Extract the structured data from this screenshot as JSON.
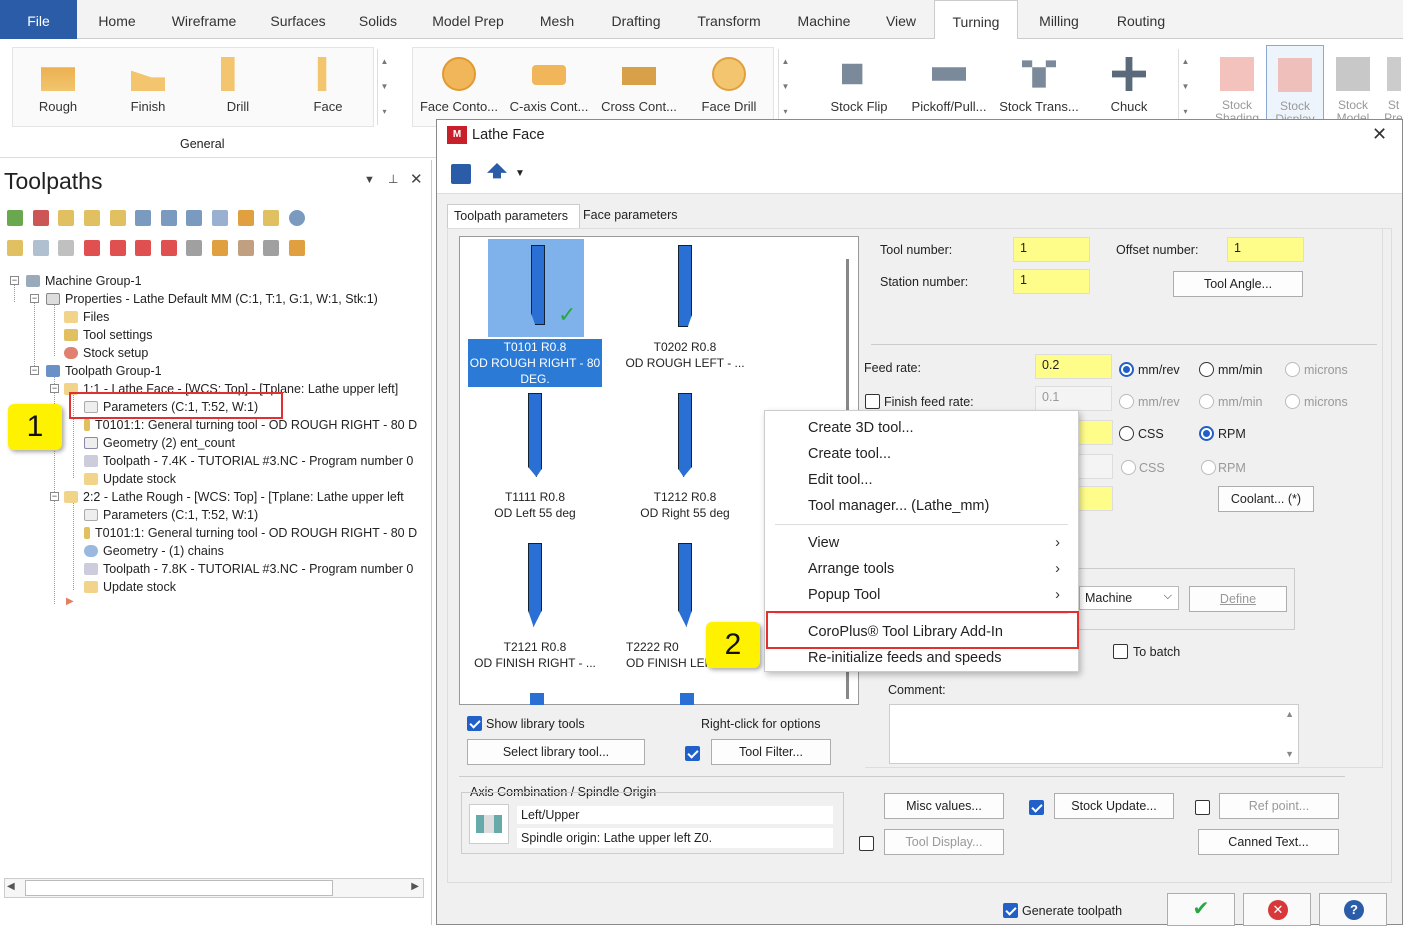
{
  "ribbon_tabs": [
    "File",
    "Home",
    "Wireframe",
    "Surfaces",
    "Solids",
    "Model Prep",
    "Mesh",
    "Drafting",
    "Transform",
    "Machine",
    "View",
    "Turning",
    "Milling",
    "Routing"
  ],
  "ribbon": {
    "general_buttons": [
      "Rough",
      "Finish",
      "Drill",
      "Face"
    ],
    "general_label": "General",
    "mid_buttons": [
      "Face Conto...",
      "C-axis Cont...",
      "Cross Cont...",
      "Face Drill"
    ],
    "stock_buttons": [
      "Stock Flip",
      "Pickoff/Pull...",
      "Stock Trans...",
      "Chuck"
    ],
    "display_buttons": [
      "Stock Shading",
      "Stock Display",
      "Stock Model",
      "St Pre"
    ]
  },
  "toolpaths": {
    "title": "Toolpaths",
    "tree": [
      "Machine Group-1",
      "Properties - Lathe Default MM  (C:1, T:1, G:1, W:1, Stk:1)",
      "Files",
      "Tool settings",
      "Stock setup",
      "Toolpath Group-1",
      "1:1 - Lathe Face - [WCS: Top] - [Tplane: Lathe upper left]",
      "Parameters  (C:1, T:52, W:1)",
      "T0101:1: General turning tool - OD ROUGH RIGHT - 80 D",
      "Geometry (2) ent_count",
      "Toolpath - 7.4K - TUTORIAL #3.NC - Program number 0",
      "Update stock",
      "2:2 - Lathe Rough - [WCS: Top] - [Tplane: Lathe upper left",
      "Parameters  (C:1, T:52, W:1)",
      "T0101:1: General turning tool - OD ROUGH RIGHT - 80 D",
      "Geometry - (1) chains",
      "Toolpath - 7.8K - TUTORIAL #3.NC - Program number 0",
      "Update stock"
    ]
  },
  "callouts": [
    "1",
    "2"
  ],
  "dialog": {
    "title": "Lathe Face",
    "tabs": [
      "Toolpath parameters",
      "Face parameters"
    ],
    "tools": [
      {
        "line1": "T0101 R0.8",
        "line2": "OD ROUGH RIGHT - 80",
        "line3": "DEG."
      },
      {
        "line1": "T0202 R0.8",
        "line2": "OD ROUGH LEFT - ..."
      },
      {
        "line1": "T1111 R0.8",
        "line2": "OD Left 55 deg"
      },
      {
        "line1": "T1212 R0.8",
        "line2": "OD Right 55 deg"
      },
      {
        "line1": "T2121 R0.8",
        "line2": "OD FINISH RIGHT - ..."
      },
      {
        "line1": "T2222 R0",
        "line2": "OD FINISH LEF"
      }
    ],
    "tool_number_label": "Tool number:",
    "tool_number": "1",
    "offset_number_label": "Offset number:",
    "offset_number": "1",
    "station_number_label": "Station number:",
    "station_number": "1",
    "tool_angle": "Tool Angle...",
    "feed_rate_label": "Feed rate:",
    "feed_rate": "0.2",
    "finish_feed_label": "Finish feed rate:",
    "finish_feed": "0.1",
    "units": [
      "mm/rev",
      "mm/min",
      "microns"
    ],
    "css": "CSS",
    "rpm": "RPM",
    "coolant": "Coolant... (*)",
    "machine_select": "Machine",
    "define": "Define",
    "to_batch": "To batch",
    "comment_label": "Comment:",
    "show_library": "Show library tools",
    "right_click": "Right-click for options",
    "select_library": "Select library tool...",
    "tool_filter": "Tool Filter...",
    "axis_combo_label": "Axis Combination / Spindle Origin",
    "axis_value": "Left/Upper",
    "spindle_origin": "Spindle origin: Lathe upper left   Z0.",
    "misc_values": "Misc values...",
    "stock_update": "Stock Update...",
    "ref_point": "Ref point...",
    "tool_display": "Tool Display...",
    "canned_text": "Canned Text...",
    "generate_toolpath": "Generate toolpath"
  },
  "context_menu": {
    "items": [
      "Create 3D tool...",
      "Create tool...",
      "Edit tool...",
      "Tool manager... (Lathe_mm)"
    ],
    "submenus": [
      "View",
      "Arrange tools",
      "Popup Tool"
    ],
    "addin": "CoroPlus® Tool Library Add-In",
    "reinit": "Re-initialize feeds and speeds"
  },
  "colors": {
    "file_tab": "#2b5ca8",
    "accent": "#2060c8",
    "field_yellow": "#fffd8a",
    "callout": "#fff200",
    "highlight": "#e03030",
    "selected_tool": "#7fb2ea"
  }
}
